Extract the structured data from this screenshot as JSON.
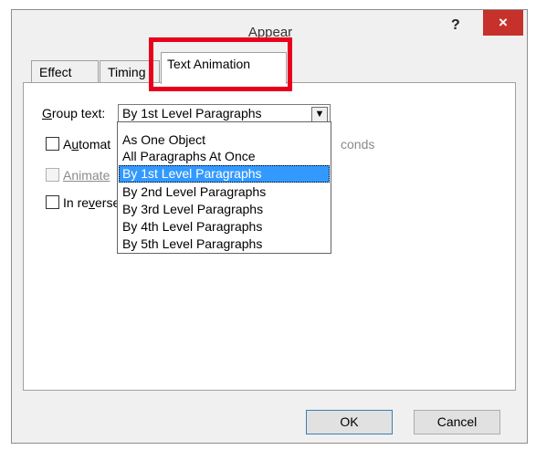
{
  "window": {
    "title": "Appear",
    "help": "?",
    "close": "×"
  },
  "tabs": [
    {
      "label": "Effect"
    },
    {
      "label": "Timing"
    },
    {
      "label": "Text Animation"
    }
  ],
  "group_text": {
    "label_first": "G",
    "label_rest": "roup text:",
    "value": "By 1st Level Paragraphs"
  },
  "automatically": {
    "label_a": "A",
    "label_u": "u",
    "label_rest": "tomat",
    "suffix": "conds"
  },
  "animate_attached": {
    "label": "Animate"
  },
  "reverse": {
    "label_a": "In re",
    "label_v": "v",
    "label_rest": "erse"
  },
  "dropdown": {
    "options": [
      "As One Object",
      "All Paragraphs At Once",
      "By 1st Level Paragraphs",
      "By 2nd Level Paragraphs",
      "By 3rd Level Paragraphs",
      "By 4th Level Paragraphs",
      "By 5th Level Paragraphs"
    ],
    "selected_index": 2
  },
  "buttons": {
    "ok": "OK",
    "cancel": "Cancel"
  }
}
